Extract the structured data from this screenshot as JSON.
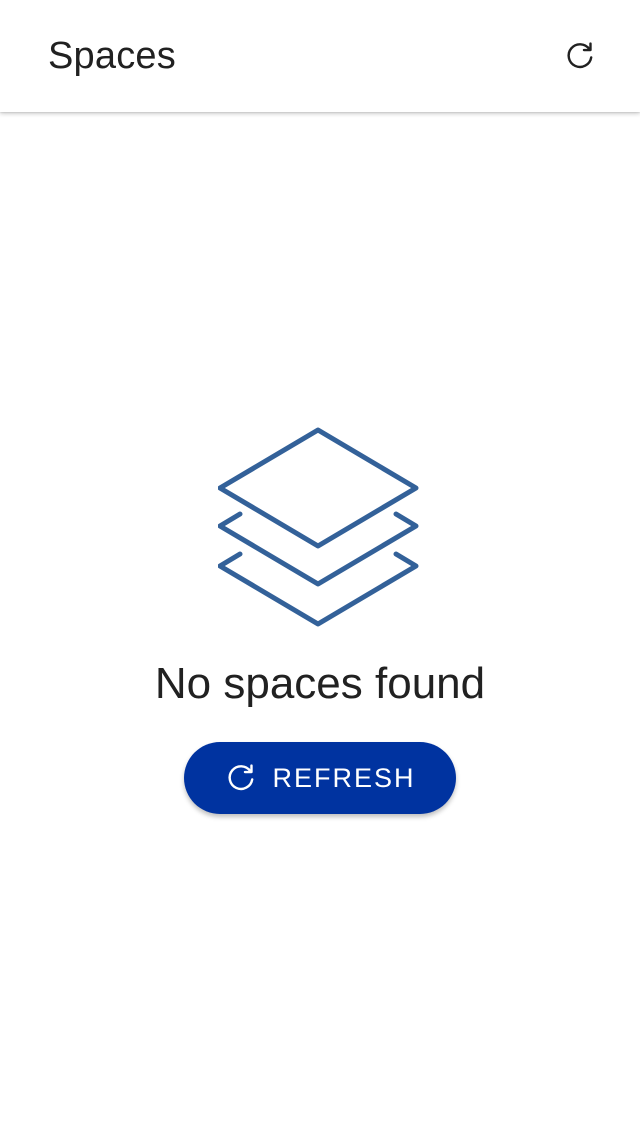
{
  "appbar": {
    "title": "Spaces",
    "refresh_icon": "refresh-icon"
  },
  "empty_state": {
    "icon": "layers-icon",
    "message": "No spaces found",
    "button_label": "REFRESH",
    "button_icon": "refresh-icon"
  },
  "colors": {
    "primary": "#0033a0",
    "icon_stroke": "#336199",
    "text": "#212121",
    "background": "#ffffff"
  }
}
